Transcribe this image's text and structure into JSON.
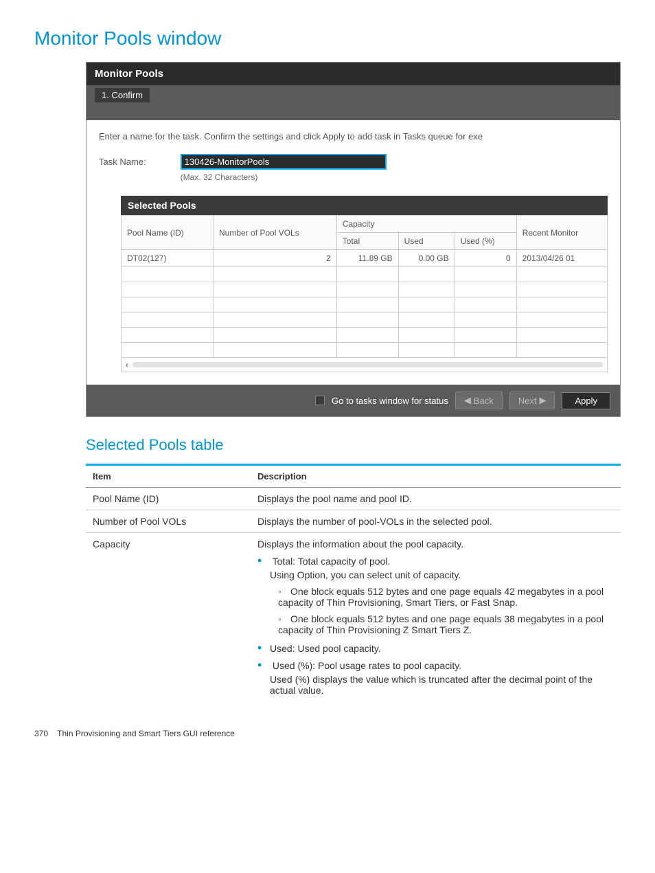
{
  "page_title": "Monitor Pools window",
  "dialog": {
    "title": "Monitor Pools",
    "step": "1. Confirm",
    "instruction": "Enter a name for the task. Confirm the settings and click Apply to add task in Tasks queue for exe",
    "task_label": "Task Name:",
    "task_value": "130426-MonitorPools",
    "task_hint": "(Max. 32 Characters)",
    "pools_header": "Selected Pools",
    "cols": {
      "pool_name": "Pool Name (ID)",
      "num_vols": "Number of Pool VOLs",
      "capacity": "Capacity",
      "total": "Total",
      "used": "Used",
      "used_pct": "Used (%)",
      "recent": "Recent Monitor"
    },
    "row": {
      "pool_name": "DT02(127)",
      "num_vols": "2",
      "total": "11.89 GB",
      "used": "0.00 GB",
      "used_pct": "0",
      "recent": "2013/04/26 01"
    },
    "footer_check_label": "Go to tasks window for status",
    "back": "Back",
    "next": "Next",
    "apply": "Apply"
  },
  "section_title": "Selected Pools table",
  "desc_table": {
    "h_item": "Item",
    "h_desc": "Description",
    "r1_item": "Pool Name (ID)",
    "r1_desc": "Displays the pool name and pool ID.",
    "r2_item": "Number of Pool VOLs",
    "r2_desc": "Displays the number of pool-VOLs in the selected pool.",
    "r3_item": "Capacity",
    "r3_intro": "Displays the information about the pool capacity.",
    "r3_b1": "Total: Total capacity of pool.",
    "r3_b1_sub": "Using Option, you can select unit of capacity.",
    "r3_c1": "One block equals 512 bytes and one page equals 42 megabytes in a pool capacity of Thin Provisioning, Smart Tiers, or Fast Snap.",
    "r3_c2": "One block equals 512 bytes and one page equals 38 megabytes in a pool capacity of Thin Provisioning Z Smart Tiers Z.",
    "r3_b2": "Used: Used pool capacity.",
    "r3_b3": "Used (%): Pool usage rates to pool capacity.",
    "r3_b3_sub": "Used (%) displays the value which is truncated after the decimal point of the actual value."
  },
  "footer": {
    "page": "370",
    "title": "Thin Provisioning and Smart Tiers GUI reference"
  }
}
